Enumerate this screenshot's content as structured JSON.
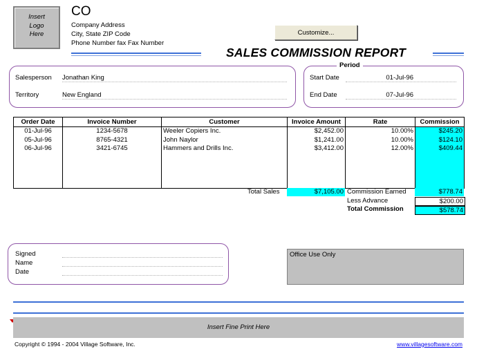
{
  "logo": {
    "line1": "Insert",
    "line2": "Logo",
    "line3": "Here"
  },
  "company": {
    "name": "CO",
    "address": "Company Address",
    "city": "City, State  ZIP Code",
    "phone": "Phone Number fax Fax Number"
  },
  "customize_label": "Customize...",
  "report_title": "SALES COMMISSION REPORT",
  "salesperson": {
    "salesperson_label": "Salesperson",
    "salesperson_value": "Jonathan King",
    "territory_label": "Territory",
    "territory_value": "New England"
  },
  "period": {
    "title": "Period",
    "start_label": "Start Date",
    "start_value": "01-Jul-96",
    "end_label": "End Date",
    "end_value": "07-Jul-96"
  },
  "table": {
    "headers": [
      "Order Date",
      "Invoice Number",
      "Customer",
      "Invoice Amount",
      "Rate",
      "Commission"
    ],
    "rows": [
      {
        "date": "01-Jul-96",
        "invoice": "1234-5678",
        "customer": "Weeler Copiers Inc.",
        "amount": "$2,452.00",
        "rate": "10.00%",
        "commission": "$245.20"
      },
      {
        "date": "05-Jul-96",
        "invoice": "8765-4321",
        "customer": "John Naylor",
        "amount": "$1,241.00",
        "rate": "10.00%",
        "commission": "$124.10"
      },
      {
        "date": "06-Jul-96",
        "invoice": "3421-6745",
        "customer": "Hammers and Drills Inc.",
        "amount": "$3,412.00",
        "rate": "12.00%",
        "commission": "$409.44"
      }
    ]
  },
  "totals": {
    "total_sales_label": "Total Sales",
    "total_sales_value": "$7,105.00",
    "commission_earned_label": "Commission Earned",
    "commission_earned_value": "$778.74",
    "less_advance_label": "Less Advance",
    "less_advance_value": "$200.00",
    "total_commission_label": "Total Commission",
    "total_commission_value": "$578.74"
  },
  "signature": {
    "signed_label": "Signed",
    "name_label": "Name",
    "date_label": "Date"
  },
  "office_use_label": "Office Use Only",
  "fine_print": "Insert Fine Print Here",
  "footer": {
    "copyright": "Copyright © 1994 - 2004 Village Software, Inc.",
    "website": "www.villagesoftware.com"
  },
  "colors": {
    "accent_blue": "#3b6fd6",
    "box_border": "#8e54a6",
    "highlight": "#00ffff",
    "gray": "#c0c0c0"
  }
}
